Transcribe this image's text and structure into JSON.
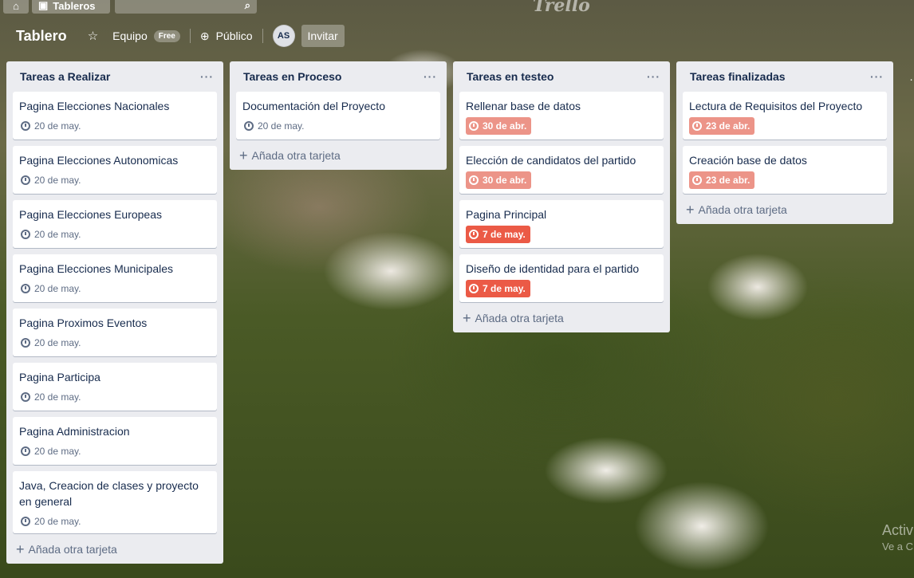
{
  "topbar": {
    "home_icon": "home-icon",
    "boards_label": "Tableros",
    "search_icon": "search-icon",
    "brand": "Trello"
  },
  "board": {
    "title": "Tablero",
    "team_label": "Equipo",
    "team_badge": "Free",
    "visibility_label": "Público",
    "avatar_initials": "AS",
    "invite_label": "Invitar"
  },
  "lists": [
    {
      "title": "Tareas a Realizar",
      "add_label": "Añada otra tarjeta",
      "cards": [
        {
          "title": "Pagina Elecciones Nacionales",
          "due": "20 de may.",
          "status": "normal"
        },
        {
          "title": "Pagina Elecciones Autonomicas",
          "due": "20 de may.",
          "status": "normal"
        },
        {
          "title": "Pagina Elecciones Europeas",
          "due": "20 de may.",
          "status": "normal"
        },
        {
          "title": "Pagina Elecciones Municipales",
          "due": "20 de may.",
          "status": "normal"
        },
        {
          "title": "Pagina Proximos Eventos",
          "due": "20 de may.",
          "status": "normal"
        },
        {
          "title": "Pagina Participa",
          "due": "20 de may.",
          "status": "normal"
        },
        {
          "title": "Pagina Administracion",
          "due": "20 de may.",
          "status": "normal"
        },
        {
          "title": "Java, Creacion de clases y proyecto en general",
          "due": "20 de may.",
          "status": "normal"
        }
      ]
    },
    {
      "title": "Tareas en Proceso",
      "add_label": "Añada otra tarjeta",
      "cards": [
        {
          "title": "Documentación del Proyecto",
          "due": "20 de may.",
          "status": "normal"
        }
      ]
    },
    {
      "title": "Tareas en testeo",
      "add_label": "Añada otra tarjeta",
      "cards": [
        {
          "title": "Rellenar base de datos",
          "due": "30 de abr.",
          "status": "past-soon"
        },
        {
          "title": "Elección de candidatos del partido",
          "due": "30 de abr.",
          "status": "past-soon"
        },
        {
          "title": "Pagina Principal",
          "due": "7 de may.",
          "status": "overdue"
        },
        {
          "title": "Diseño de identidad para el partido",
          "due": "7 de may.",
          "status": "overdue"
        }
      ]
    },
    {
      "title": "Tareas finalizadas",
      "add_label": "Añada otra tarjeta",
      "cards": [
        {
          "title": "Lectura de Requisitos del Proyecto",
          "due": "23 de abr.",
          "status": "past-soon"
        },
        {
          "title": "Creación base de datos",
          "due": "23 de abr.",
          "status": "past-soon"
        }
      ]
    }
  ],
  "list_menu_glyph": "···",
  "watermark": {
    "line1": "Activ",
    "line2": "Ve a C"
  },
  "colors": {
    "list_bg": "#ebecf0",
    "due_past": "#ec9488",
    "due_overdue": "#eb5a46"
  }
}
